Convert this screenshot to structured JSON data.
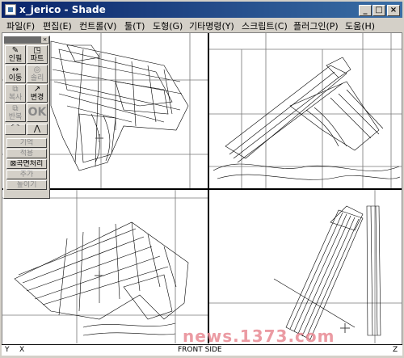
{
  "window": {
    "title": "x_jerico - Shade"
  },
  "menu": [
    {
      "label": "파일(F)"
    },
    {
      "label": "편집(E)"
    },
    {
      "label": "컨트롤(V)"
    },
    {
      "label": "툴(T)"
    },
    {
      "label": "도형(G)"
    },
    {
      "label": "기타명령(Y)"
    },
    {
      "label": "스크립트(C)"
    },
    {
      "label": "플러그인(P)"
    },
    {
      "label": "도움(H)"
    }
  ],
  "palette": {
    "tools": [
      {
        "icon": "pencil-icon",
        "label": "인필"
      },
      {
        "icon": "shapes-icon",
        "label": "파트"
      },
      {
        "icon": "move-icon",
        "label": "이동"
      },
      {
        "icon": "rotate-icon",
        "label": "솔리드"
      },
      {
        "icon": "copy-icon",
        "label": "복사"
      },
      {
        "icon": "transform-icon",
        "label": "변경"
      },
      {
        "icon": "copy2-icon",
        "label": "반복"
      },
      {
        "icon": "ok-icon",
        "label": "OK"
      }
    ],
    "buttons": [
      {
        "label": "기억",
        "enabled": false
      },
      {
        "label": "적용",
        "enabled": false
      },
      {
        "label": "⊠곡면처리",
        "enabled": true
      },
      {
        "label": "추가",
        "enabled": false
      },
      {
        "label": "높이기",
        "enabled": false
      }
    ]
  },
  "statusbar": {
    "left_marker": "Y",
    "x_left": "X",
    "view_name": "FRONT SIDE",
    "z_right": "Z"
  },
  "watermark": "news.1373.com"
}
